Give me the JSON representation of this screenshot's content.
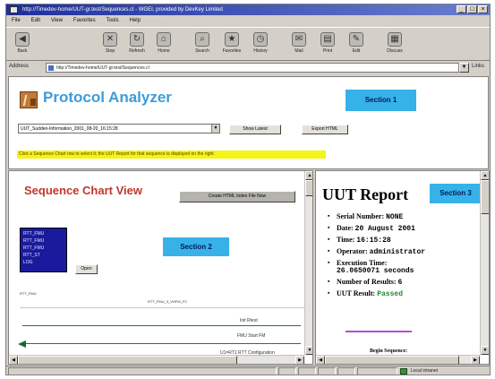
{
  "browser": {
    "title": "http://Timedev-home/UUT-gr.test/Sequences.cl - WGEI, provided by DevKey Limited",
    "window_buttons": [
      "_",
      "□",
      "×"
    ],
    "menu": [
      "File",
      "Edit",
      "View",
      "Favorites",
      "Tools",
      "Help"
    ],
    "toolbar": [
      {
        "label": "Back",
        "icon": "back-arrow-icon",
        "glyph": "◀"
      },
      {
        "label": "Stop",
        "icon": "stop-icon",
        "glyph": "✕"
      },
      {
        "label": "Refresh",
        "icon": "refresh-icon",
        "glyph": "↻"
      },
      {
        "label": "Home",
        "icon": "home-icon",
        "glyph": "⌂"
      },
      {
        "label": "Search",
        "icon": "search-icon",
        "glyph": "⌕"
      },
      {
        "label": "Favorites",
        "icon": "favorites-icon",
        "glyph": "★"
      },
      {
        "label": "History",
        "icon": "history-icon",
        "glyph": "◷"
      },
      {
        "label": "Mail",
        "icon": "mail-icon",
        "glyph": "✉"
      },
      {
        "label": "Print",
        "icon": "print-icon",
        "glyph": "▤"
      },
      {
        "label": "Edit",
        "icon": "edit-icon",
        "glyph": "✎"
      },
      {
        "label": "Discuss",
        "icon": "discuss-icon",
        "glyph": "▦"
      }
    ],
    "address_label": "Address",
    "address": "http://Timedev-home/UUT-gr.test/Sequences.cl",
    "links_label": "Links",
    "status_zone": "Local intranet"
  },
  "top": {
    "app_title": "Protocol Analyzer",
    "callout": "Section 1",
    "session": "UUT_Sudden-Information_2001_08-20_16:15:28",
    "show_latest_label": "Show Latest",
    "export_label": "Export HTML",
    "status_strip": "Click a Sequence Chart row to select it; the UUT Report for that sequence is displayed on the right."
  },
  "left": {
    "title": "Sequence Chart View",
    "create_index_label": "Create HTML Index File Now",
    "callout": "Section 2",
    "rtt_items": [
      "RTT_FMU",
      "RTT_FMU",
      "RTT_FMU",
      "RTT_ST",
      "LOG"
    ],
    "open_label": "Open",
    "lane_label": "RTT_FMU",
    "lane_header": "RTT_FMU_3_VHFM_FC",
    "messages": [
      "Init Rtest",
      "FMU Start FM",
      "U1=RT1 RTT Configuration"
    ]
  },
  "right": {
    "title": "UUT Report",
    "callout": "Section 3",
    "fields": [
      {
        "key": "Serial Number:",
        "value": "NONE",
        "wrap": false,
        "pass": false
      },
      {
        "key": "Date:",
        "value": "20 August 2001",
        "wrap": false,
        "pass": false
      },
      {
        "key": "Time:",
        "value": "16:15:28",
        "wrap": false,
        "pass": false
      },
      {
        "key": "Operator:",
        "value": "administrator",
        "wrap": false,
        "pass": false
      },
      {
        "key": "Execution Time:",
        "value": "26.0650071 seconds",
        "wrap": true,
        "pass": false
      },
      {
        "key": "Number of Results:",
        "value": "6",
        "wrap": false,
        "pass": false
      },
      {
        "key": "UUT Result:",
        "value": "Passed",
        "wrap": false,
        "pass": true
      }
    ],
    "footer": "Begin Sequence:"
  },
  "colors": {
    "titlebar": "#1f2f9a",
    "app_title": "#3e9bd6",
    "section_callout": "#36b2e8",
    "sequence_title": "#c2362a",
    "rtt_list_bg": "#1a1a9c",
    "message_line": "#1d7c2a",
    "status_strip": "#f4f417",
    "pass_text": "#1e8c2c",
    "report_separator": "#b14fcf"
  }
}
